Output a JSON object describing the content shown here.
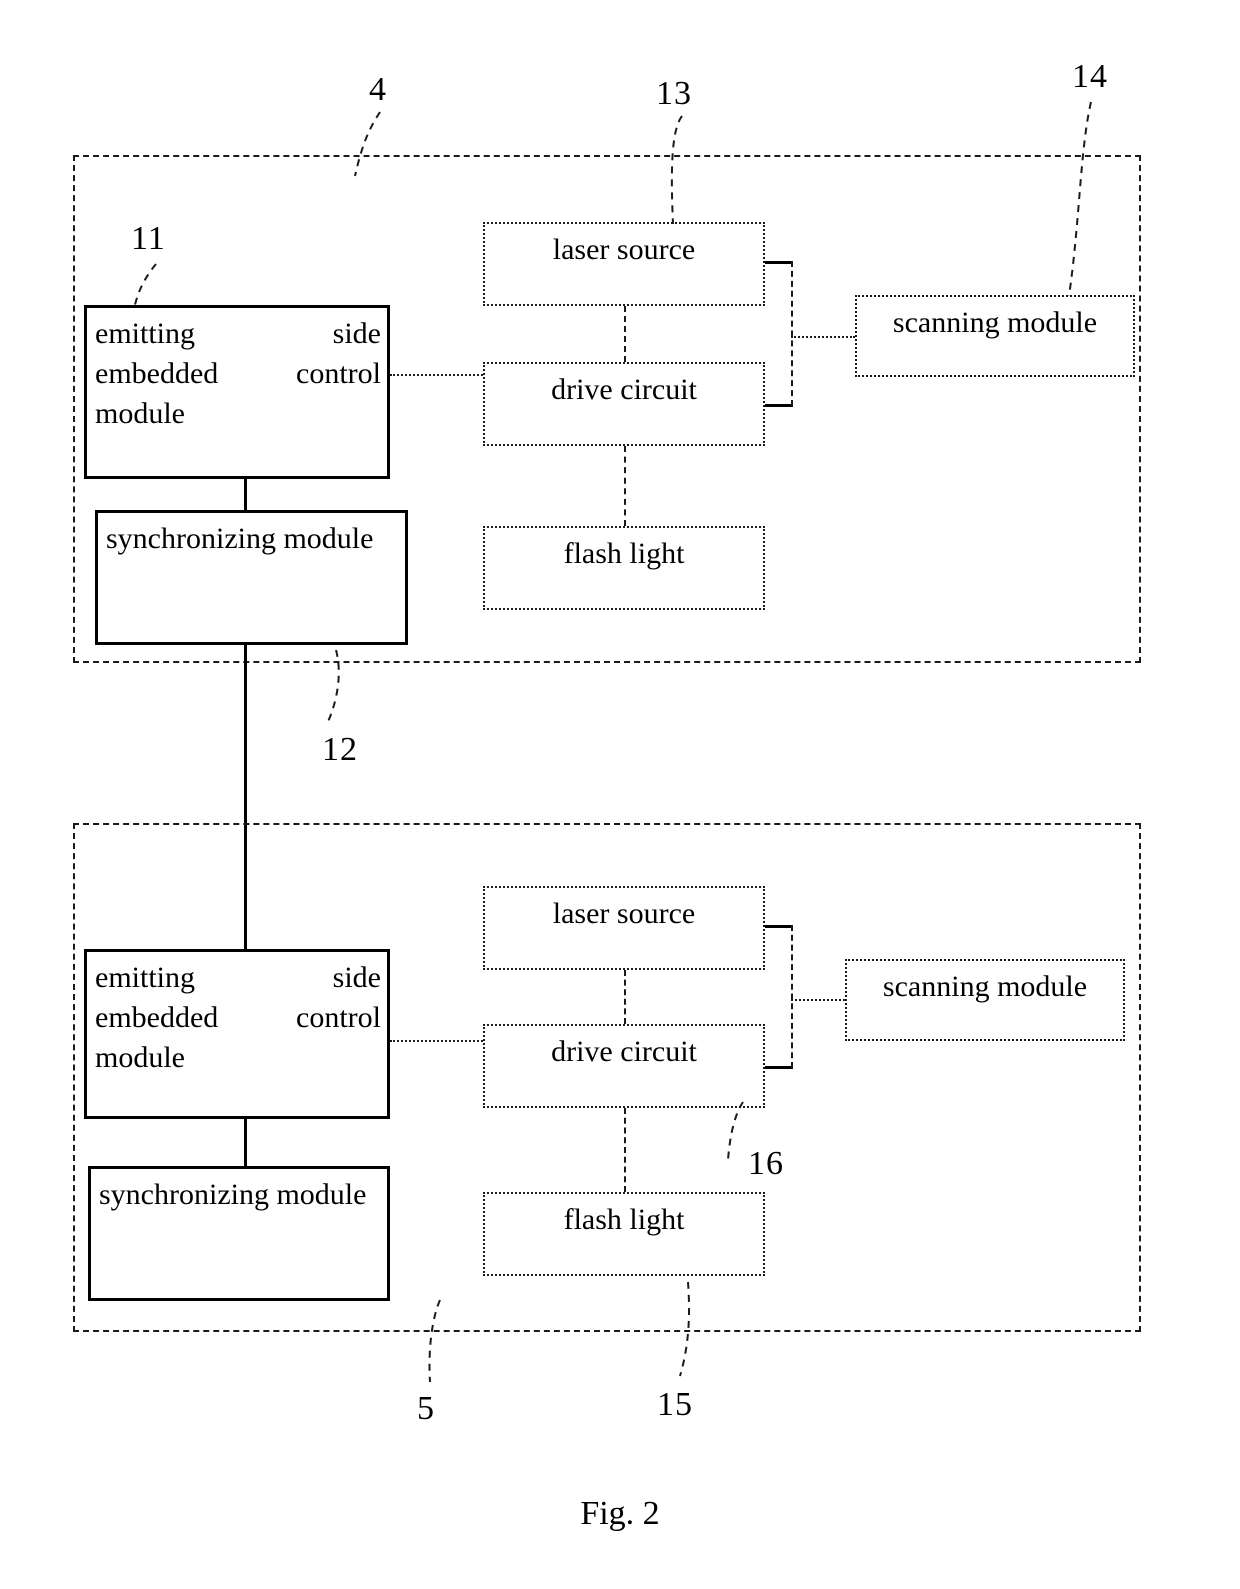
{
  "figure": {
    "caption": "Fig. 2",
    "background_color": "#ffffff",
    "line_color": "#000000"
  },
  "upper_system": {
    "reference_numeral": "4",
    "blocks": {
      "control_module": {
        "label": "emitting side embedded control module",
        "reference_numeral": "11",
        "border_style": "solid"
      },
      "sync_module": {
        "label": "synchronizing module",
        "reference_numeral": "12",
        "border_style": "solid"
      },
      "laser_source": {
        "label": "laser source",
        "reference_numeral": "13",
        "border_style": "dotted"
      },
      "drive_circuit": {
        "label": "drive circuit",
        "border_style": "dotted"
      },
      "flash_light": {
        "label": "flash light",
        "border_style": "dotted"
      },
      "scanning_module": {
        "label": "scanning module",
        "reference_numeral": "14",
        "border_style": "dotted"
      }
    }
  },
  "lower_system": {
    "reference_numeral": "5",
    "blocks": {
      "control_module": {
        "label": "emitting side embedded control module",
        "border_style": "solid"
      },
      "sync_module": {
        "label": "synchronizing module",
        "border_style": "solid"
      },
      "laser_source": {
        "label": "laser source",
        "border_style": "dotted"
      },
      "drive_circuit": {
        "label": "drive circuit",
        "reference_numeral": "16",
        "border_style": "dotted"
      },
      "flash_light": {
        "label": "flash light",
        "reference_numeral": "15",
        "border_style": "dotted"
      },
      "scanning_module": {
        "label": "scanning module",
        "border_style": "dotted"
      }
    }
  }
}
